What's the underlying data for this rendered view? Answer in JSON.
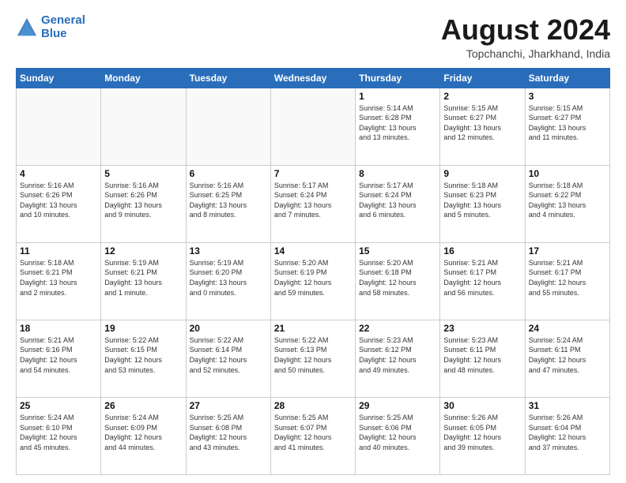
{
  "header": {
    "logo_line1": "General",
    "logo_line2": "Blue",
    "title": "August 2024",
    "subtitle": "Topchanchi, Jharkhand, India"
  },
  "days_of_week": [
    "Sunday",
    "Monday",
    "Tuesday",
    "Wednesday",
    "Thursday",
    "Friday",
    "Saturday"
  ],
  "weeks": [
    [
      {
        "day": "",
        "info": ""
      },
      {
        "day": "",
        "info": ""
      },
      {
        "day": "",
        "info": ""
      },
      {
        "day": "",
        "info": ""
      },
      {
        "day": "1",
        "info": "Sunrise: 5:14 AM\nSunset: 6:28 PM\nDaylight: 13 hours\nand 13 minutes."
      },
      {
        "day": "2",
        "info": "Sunrise: 5:15 AM\nSunset: 6:27 PM\nDaylight: 13 hours\nand 12 minutes."
      },
      {
        "day": "3",
        "info": "Sunrise: 5:15 AM\nSunset: 6:27 PM\nDaylight: 13 hours\nand 11 minutes."
      }
    ],
    [
      {
        "day": "4",
        "info": "Sunrise: 5:16 AM\nSunset: 6:26 PM\nDaylight: 13 hours\nand 10 minutes."
      },
      {
        "day": "5",
        "info": "Sunrise: 5:16 AM\nSunset: 6:26 PM\nDaylight: 13 hours\nand 9 minutes."
      },
      {
        "day": "6",
        "info": "Sunrise: 5:16 AM\nSunset: 6:25 PM\nDaylight: 13 hours\nand 8 minutes."
      },
      {
        "day": "7",
        "info": "Sunrise: 5:17 AM\nSunset: 6:24 PM\nDaylight: 13 hours\nand 7 minutes."
      },
      {
        "day": "8",
        "info": "Sunrise: 5:17 AM\nSunset: 6:24 PM\nDaylight: 13 hours\nand 6 minutes."
      },
      {
        "day": "9",
        "info": "Sunrise: 5:18 AM\nSunset: 6:23 PM\nDaylight: 13 hours\nand 5 minutes."
      },
      {
        "day": "10",
        "info": "Sunrise: 5:18 AM\nSunset: 6:22 PM\nDaylight: 13 hours\nand 4 minutes."
      }
    ],
    [
      {
        "day": "11",
        "info": "Sunrise: 5:18 AM\nSunset: 6:21 PM\nDaylight: 13 hours\nand 2 minutes."
      },
      {
        "day": "12",
        "info": "Sunrise: 5:19 AM\nSunset: 6:21 PM\nDaylight: 13 hours\nand 1 minute."
      },
      {
        "day": "13",
        "info": "Sunrise: 5:19 AM\nSunset: 6:20 PM\nDaylight: 13 hours\nand 0 minutes."
      },
      {
        "day": "14",
        "info": "Sunrise: 5:20 AM\nSunset: 6:19 PM\nDaylight: 12 hours\nand 59 minutes."
      },
      {
        "day": "15",
        "info": "Sunrise: 5:20 AM\nSunset: 6:18 PM\nDaylight: 12 hours\nand 58 minutes."
      },
      {
        "day": "16",
        "info": "Sunrise: 5:21 AM\nSunset: 6:17 PM\nDaylight: 12 hours\nand 56 minutes."
      },
      {
        "day": "17",
        "info": "Sunrise: 5:21 AM\nSunset: 6:17 PM\nDaylight: 12 hours\nand 55 minutes."
      }
    ],
    [
      {
        "day": "18",
        "info": "Sunrise: 5:21 AM\nSunset: 6:16 PM\nDaylight: 12 hours\nand 54 minutes."
      },
      {
        "day": "19",
        "info": "Sunrise: 5:22 AM\nSunset: 6:15 PM\nDaylight: 12 hours\nand 53 minutes."
      },
      {
        "day": "20",
        "info": "Sunrise: 5:22 AM\nSunset: 6:14 PM\nDaylight: 12 hours\nand 52 minutes."
      },
      {
        "day": "21",
        "info": "Sunrise: 5:22 AM\nSunset: 6:13 PM\nDaylight: 12 hours\nand 50 minutes."
      },
      {
        "day": "22",
        "info": "Sunrise: 5:23 AM\nSunset: 6:12 PM\nDaylight: 12 hours\nand 49 minutes."
      },
      {
        "day": "23",
        "info": "Sunrise: 5:23 AM\nSunset: 6:11 PM\nDaylight: 12 hours\nand 48 minutes."
      },
      {
        "day": "24",
        "info": "Sunrise: 5:24 AM\nSunset: 6:11 PM\nDaylight: 12 hours\nand 47 minutes."
      }
    ],
    [
      {
        "day": "25",
        "info": "Sunrise: 5:24 AM\nSunset: 6:10 PM\nDaylight: 12 hours\nand 45 minutes."
      },
      {
        "day": "26",
        "info": "Sunrise: 5:24 AM\nSunset: 6:09 PM\nDaylight: 12 hours\nand 44 minutes."
      },
      {
        "day": "27",
        "info": "Sunrise: 5:25 AM\nSunset: 6:08 PM\nDaylight: 12 hours\nand 43 minutes."
      },
      {
        "day": "28",
        "info": "Sunrise: 5:25 AM\nSunset: 6:07 PM\nDaylight: 12 hours\nand 41 minutes."
      },
      {
        "day": "29",
        "info": "Sunrise: 5:25 AM\nSunset: 6:06 PM\nDaylight: 12 hours\nand 40 minutes."
      },
      {
        "day": "30",
        "info": "Sunrise: 5:26 AM\nSunset: 6:05 PM\nDaylight: 12 hours\nand 39 minutes."
      },
      {
        "day": "31",
        "info": "Sunrise: 5:26 AM\nSunset: 6:04 PM\nDaylight: 12 hours\nand 37 minutes."
      }
    ]
  ]
}
